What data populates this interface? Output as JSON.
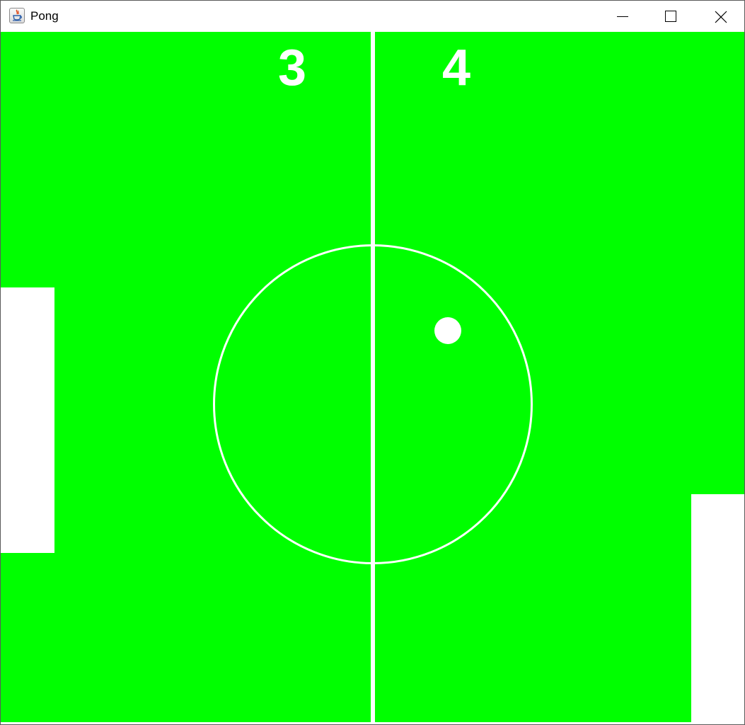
{
  "window": {
    "title": "Pong",
    "app_icon": "java-cup-icon",
    "controls": [
      "minimize-icon",
      "maximize-icon",
      "close-icon"
    ]
  },
  "game": {
    "score_left": "3",
    "score_right": "4",
    "colors": {
      "field": "#00ff00",
      "lines": "#ffffff",
      "paddles": "#ffffff",
      "ball": "#ffffff"
    }
  }
}
